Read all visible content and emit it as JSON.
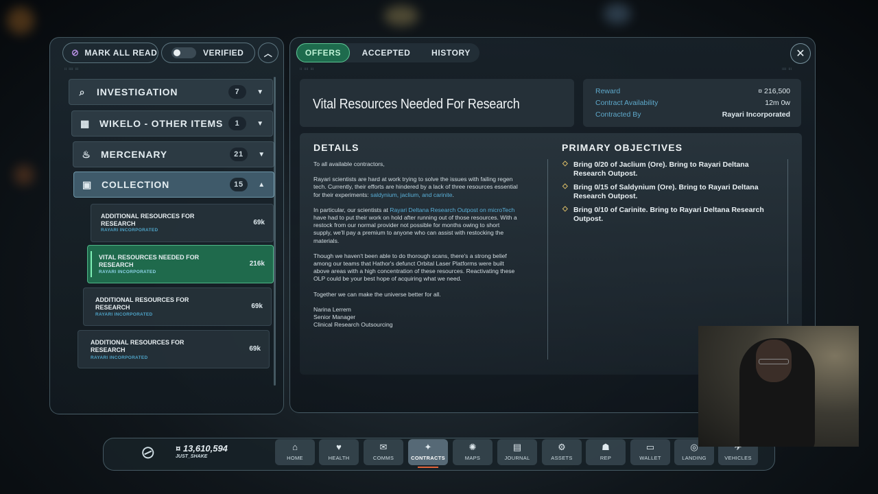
{
  "left": {
    "mark_all_read": "MARK ALL READ",
    "verified": "VERIFIED",
    "categories": [
      {
        "label": "INVESTIGATION",
        "count": "7",
        "icon": "magnifier-icon"
      },
      {
        "label": "WIKELO - OTHER ITEMS",
        "count": "1",
        "icon": "calendar-icon"
      },
      {
        "label": "MERCENARY",
        "count": "21",
        "icon": "flame-icon"
      },
      {
        "label": "COLLECTION",
        "count": "15",
        "icon": "crate-icon"
      }
    ],
    "contracts": [
      {
        "title": "ADDITIONAL RESOURCES FOR RESEARCH",
        "org": "RAYARI INCORPORATED",
        "pay": "69k"
      },
      {
        "title": "VITAL RESOURCES NEEDED FOR RESEARCH",
        "org": "RAYARI INCORPORATED",
        "pay": "216k"
      },
      {
        "title": "ADDITIONAL RESOURCES FOR RESEARCH",
        "org": "RAYARI INCORPORATED",
        "pay": "69k"
      },
      {
        "title": "ADDITIONAL RESOURCES FOR RESEARCH",
        "org": "RAYARI INCORPORATED",
        "pay": "69k"
      }
    ]
  },
  "tabs": [
    "OFFERS",
    "ACCEPTED",
    "HISTORY"
  ],
  "detail": {
    "title": "Vital Resources Needed For Research",
    "reward_label": "Reward",
    "reward_value": "¤ 216,500",
    "availability_label": "Contract Availability",
    "availability_value": "12m 0w",
    "contracted_label": "Contracted By",
    "contracted_value": "Rayari Incorporated",
    "details_heading": "DETAILS",
    "objectives_heading": "PRIMARY OBJECTIVES",
    "greeting": "To all available contractors,",
    "p1_a": "Rayari scientists are hard at work trying to solve the issues with failing regen tech. Currently, their efforts are hindered by a lack of three resources essential for their experiments: ",
    "p1_hl": "saldynium, jaclium, and carinite",
    "p1_b": ".",
    "p2_a": "In particular, our scientists at ",
    "p2_hl": "Rayari Deltana Research Outpost on microTech",
    "p2_b": " have had to put their work on hold after running out of those resources. With a restock from our normal provider not possible for months owing to short supply, we'll pay a premium to anyone who can assist with restocking the materials.",
    "p3": "Though we haven't been able to do thorough scans, there's a strong belief among our teams that Hathor's defunct Orbital Laser Platforms were built above areas with a high concentration of these resources. Reactivating these OLP could be your best hope of acquiring what we need.",
    "p4": "Together we can make the universe better for all.",
    "sig1": "Narina Lerrem",
    "sig2": "Senior Manager",
    "sig3": "Clinical Research Outsourcing",
    "objectives": [
      "Bring 0/20 of Jaclium (Ore). Bring to Rayari Deltana Research Outpost.",
      "Bring 0/15 of Saldynium (Ore). Bring to Rayari Deltana Research Outpost.",
      "Bring 0/10 of Carinite. Bring to Rayari Deltana Research Outpost."
    ]
  },
  "bottom": {
    "balance": "¤ 13,610,594",
    "handle": "JUST_SHAKE",
    "nav": [
      {
        "label": "HOME",
        "icon": "home-icon"
      },
      {
        "label": "HEALTH",
        "icon": "health-icon"
      },
      {
        "label": "COMMS",
        "icon": "comms-icon"
      },
      {
        "label": "CONTRACTS",
        "icon": "contracts-icon"
      },
      {
        "label": "MAPS",
        "icon": "maps-icon"
      },
      {
        "label": "JOURNAL",
        "icon": "journal-icon"
      },
      {
        "label": "ASSETS",
        "icon": "assets-icon"
      },
      {
        "label": "REP",
        "icon": "rep-icon"
      },
      {
        "label": "WALLET",
        "icon": "wallet-icon"
      },
      {
        "label": "LANDING",
        "icon": "landing-icon"
      },
      {
        "label": "VEHICLES",
        "icon": "vehicles-icon"
      }
    ]
  }
}
